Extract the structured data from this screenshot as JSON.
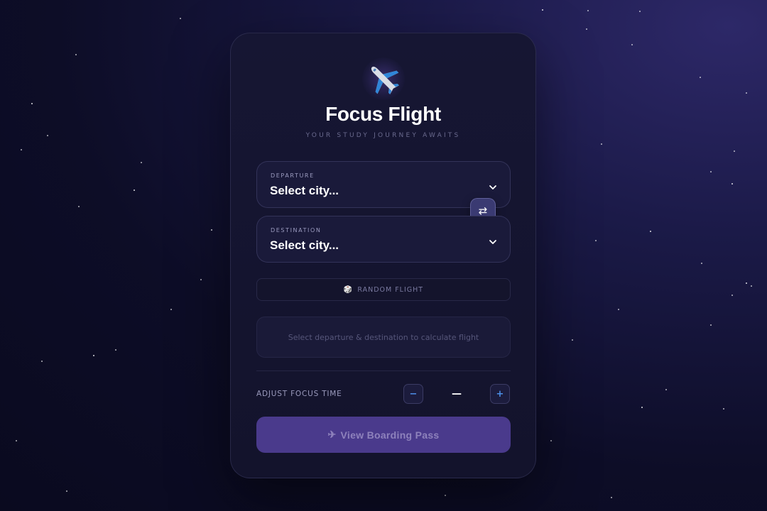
{
  "app": {
    "title": "Focus Flight",
    "subtitle": "YOUR STUDY JOURNEY AWAITS"
  },
  "departure": {
    "label": "DEPARTURE",
    "value": "Select city..."
  },
  "destination": {
    "label": "DESTINATION",
    "value": "Select city..."
  },
  "swap": {
    "glyph": "⇄"
  },
  "random_flight": {
    "icon": "🎲",
    "label": "RANDOM FLIGHT"
  },
  "info_message": "Select departure & destination to calculate flight",
  "focus_time": {
    "label": "ADJUST FOCUS TIME",
    "minus_label": "−",
    "value": "—",
    "plus_label": "+"
  },
  "boarding_pass": {
    "icon": "✈",
    "label": "View Boarding Pass"
  },
  "colors": {
    "accent": "#4a3a8c",
    "stepper_glyph": "#4d8fe8",
    "background": "#0d0d27"
  },
  "icons": [
    "airplane-icon",
    "swap-icon",
    "chevron-down-icon",
    "dice-icon",
    "plane-small-icon"
  ]
}
